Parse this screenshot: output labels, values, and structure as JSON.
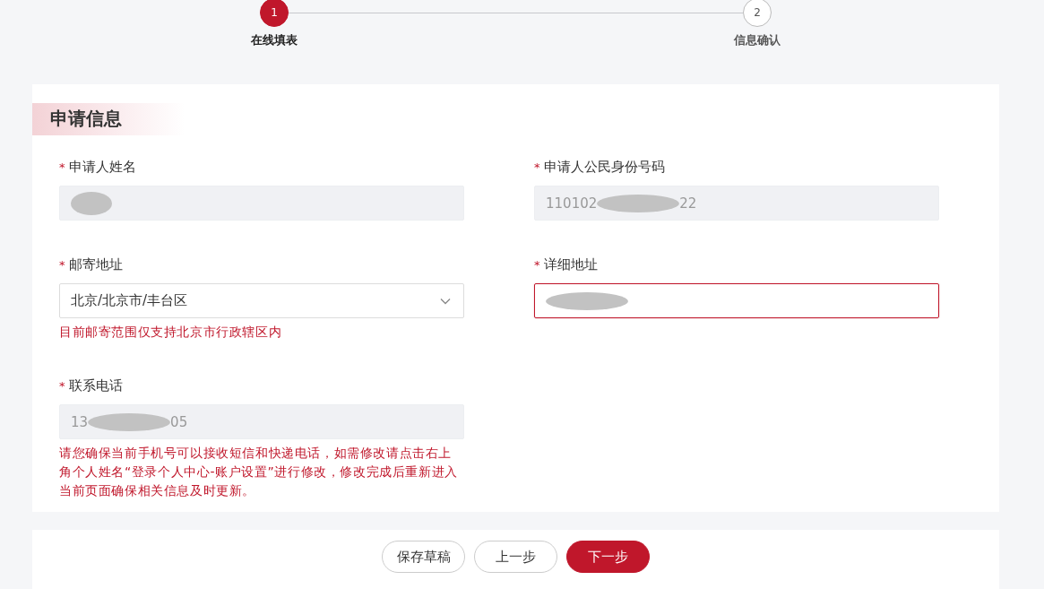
{
  "steps": [
    {
      "number": "1",
      "label": "在线填表",
      "selected": true
    },
    {
      "number": "2",
      "label": "信息确认",
      "selected": false
    }
  ],
  "section": {
    "title": "申请信息"
  },
  "fields": [
    {
      "label": "申请人姓名",
      "required_mark": "*",
      "kind": "readonly",
      "redacted": true
    },
    {
      "label": "申请人公民身份号码",
      "required_mark": "*",
      "kind": "readonly",
      "value_start": "110102",
      "redacted": true,
      "value_end": "22"
    },
    {
      "label": "邮寄地址",
      "required_mark": "*",
      "kind": "select",
      "value": "北京/北京市/丰台区",
      "hint": "目前邮寄范围仅支持北京市行政辖区内"
    },
    {
      "label": "详细地址",
      "required_mark": "*",
      "kind": "text",
      "redacted": true,
      "error": true
    },
    {
      "label": "联系电话",
      "required_mark": "*",
      "kind": "readonly",
      "value_start": "13",
      "redacted": true,
      "value_end": "05",
      "hint": "请您确保当前手机号可以接收短信和快递电话，如需修改请点击右上角个人姓名“登录个人中心-账户设置”进行修改，修改完成后重新进入当前页面确保相关信息及时更新。"
    }
  ],
  "buttons": [
    {
      "label": "保存草稿",
      "primary": false
    },
    {
      "label": "上一步",
      "primary": false
    },
    {
      "label": "下一步",
      "primary": true
    }
  ]
}
